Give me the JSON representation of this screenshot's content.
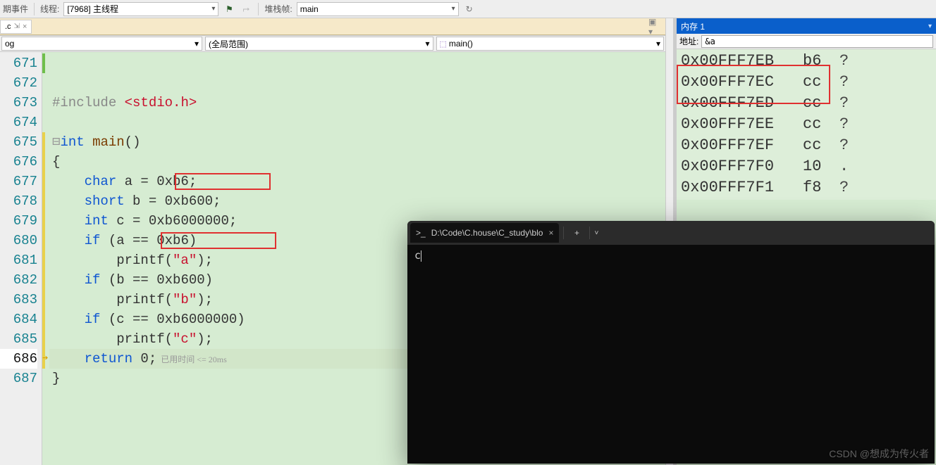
{
  "toolbar": {
    "event_label": "期事件",
    "thread_label": "线程:",
    "thread_value": "[7968] 主线程",
    "stack_label": "堆栈帧:",
    "stack_value": "main"
  },
  "tab": {
    "file_label": ".c",
    "pinned": "⇲",
    "close": "×"
  },
  "nav": {
    "scope1": "og",
    "scope2": "(全局范围)",
    "scope3": "main()"
  },
  "code": {
    "lines": {
      "671": "",
      "672": "",
      "673_pre": "#include ",
      "673_inc": "<stdio.h>",
      "674": "",
      "675_kw": "int ",
      "675_fn": "main",
      "675_rest": "()",
      "676": "{",
      "677_a": "    ",
      "677_kw": "char",
      "677_rest": " a = 0xb6;",
      "678_a": "    ",
      "678_kw": "short",
      "678_rest": " b = 0xb600;",
      "679_a": "    ",
      "679_kw": "int",
      "679_rest": " c = 0xb6000000;",
      "680_a": "    ",
      "680_kw": "if",
      "680_rest": " (a == 0xb6)",
      "681_a": "        printf(",
      "681_str": "\"a\"",
      "681_b": ");",
      "682_a": "    ",
      "682_kw": "if",
      "682_rest": " (b == 0xb600)",
      "683_a": "        printf(",
      "683_str": "\"b\"",
      "683_b": ");",
      "684_a": "    ",
      "684_kw": "if",
      "684_rest": " (c == 0xb6000000)",
      "685_a": "        printf(",
      "685_str": "\"c\"",
      "685_b": ");",
      "686_a": "    ",
      "686_kw": "return",
      "686_rest": " 0;",
      "686_hint": "  已用时间 <= 20ms",
      "687": "}"
    },
    "line_numbers": [
      "671",
      "672",
      "673",
      "674",
      "675",
      "676",
      "677",
      "678",
      "679",
      "680",
      "681",
      "682",
      "683",
      "684",
      "685",
      "686",
      "687"
    ]
  },
  "memory": {
    "title": "内存 1",
    "addr_label": "地址:",
    "addr_value": "&a",
    "rows": [
      {
        "addr": "0x00FFF7EB",
        "hex": "b6",
        "ascii": "?"
      },
      {
        "addr": "0x00FFF7EC",
        "hex": "cc",
        "ascii": "?"
      },
      {
        "addr": "0x00FFF7ED",
        "hex": "cc",
        "ascii": "?"
      },
      {
        "addr": "0x00FFF7EE",
        "hex": "cc",
        "ascii": "?"
      },
      {
        "addr": "0x00FFF7EF",
        "hex": "cc",
        "ascii": "?"
      },
      {
        "addr": "0x00FFF7F0",
        "hex": "10",
        "ascii": "."
      },
      {
        "addr": "0x00FFF7F1",
        "hex": "f8",
        "ascii": "?"
      }
    ]
  },
  "terminal": {
    "tab_title": "D:\\Code\\C.house\\C_study\\blo",
    "output": "c"
  },
  "watermark": "CSDN @想成为传火者"
}
